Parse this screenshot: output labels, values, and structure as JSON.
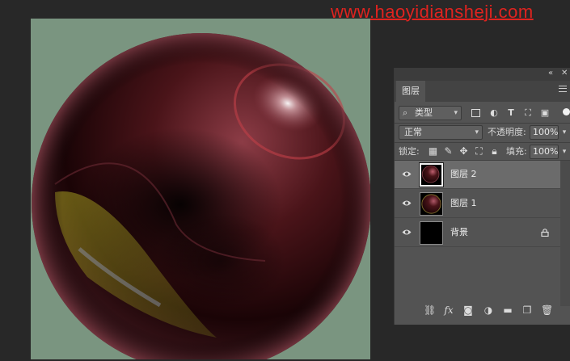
{
  "watermark": {
    "text": "www.haoyidiansheji.com",
    "color": "#e0231f"
  },
  "canvas": {
    "background": "#7a9580",
    "sphere_color": "#5a1e24"
  },
  "panel": {
    "topbar": {
      "collapse_glyph": "«",
      "close_glyph": "✕"
    },
    "tab_label": "图层",
    "menu_icon": "panel-menu-icon",
    "filter": {
      "kind_label": "类型",
      "icons": [
        "image-filter-icon",
        "adjustment-filter-icon",
        "type-filter-icon",
        "shape-filter-icon",
        "smart-object-filter-icon"
      ]
    },
    "blend_mode": "正常",
    "opacity_label": "不透明度:",
    "opacity_value": "100%",
    "lock_label": "锁定:",
    "lock_icons": [
      "lock-transparent-icon",
      "lock-brush-icon",
      "lock-move-icon",
      "lock-artboard-icon",
      "lock-all-icon"
    ],
    "fill_label": "填充:",
    "fill_value": "100%",
    "layers": [
      {
        "name": "图层 2",
        "selected": true,
        "visible": true,
        "locked": false,
        "thumb": "sphere"
      },
      {
        "name": "图层 1",
        "selected": false,
        "visible": true,
        "locked": false,
        "thumb": "sphere"
      },
      {
        "name": "背景",
        "selected": false,
        "visible": true,
        "locked": true,
        "thumb": "black"
      }
    ],
    "footer_icons": [
      "link-layers-icon",
      "fx-icon",
      "add-mask-icon",
      "adjustment-layer-icon",
      "new-group-icon",
      "new-layer-icon",
      "delete-icon"
    ],
    "fx_label": "fx"
  }
}
